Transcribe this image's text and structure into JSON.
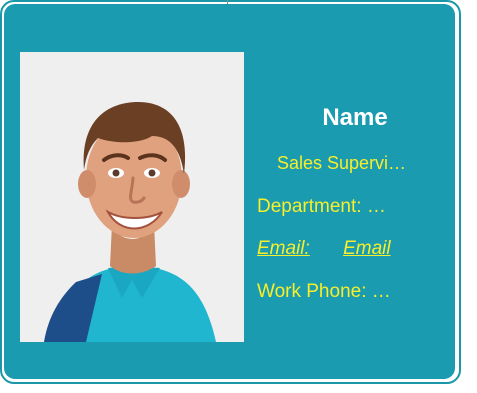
{
  "card": {
    "name": "Name",
    "title": "Sales Supervi…",
    "department": "Department:  …",
    "email_label": "Email:",
    "email_value": "Email",
    "work_phone": "Work Phone: …"
  },
  "colors": {
    "card_background": "#1a9bb0",
    "border": "#1a98a8",
    "name_text": "#ffffff",
    "detail_text": "#f6ef2a"
  }
}
